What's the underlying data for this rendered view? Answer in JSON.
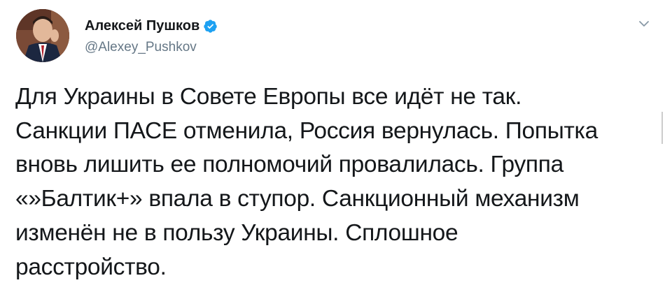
{
  "author": {
    "display_name": "Алексей Пушков",
    "handle": "@Alexey_Pushkov",
    "verified": true
  },
  "tweet": {
    "lines": [
      "Для Украины в Совете Европы все идёт не так.",
      "Санкции ПАСЕ отменила, Россия вернулась. Попытка",
      "вновь лишить ее полномочий провалилась. Группа",
      "«»Балтик+» впала в ступор. Санкционный механизм",
      "изменён не в пользу Украины. Сплошное",
      "расстройство."
    ]
  },
  "icons": {
    "verified": "verified-badge-icon",
    "menu": "chevron-down-icon"
  },
  "colors": {
    "verified_blue": "#1da1f2",
    "text": "#14171a",
    "secondary_text": "#657786"
  }
}
